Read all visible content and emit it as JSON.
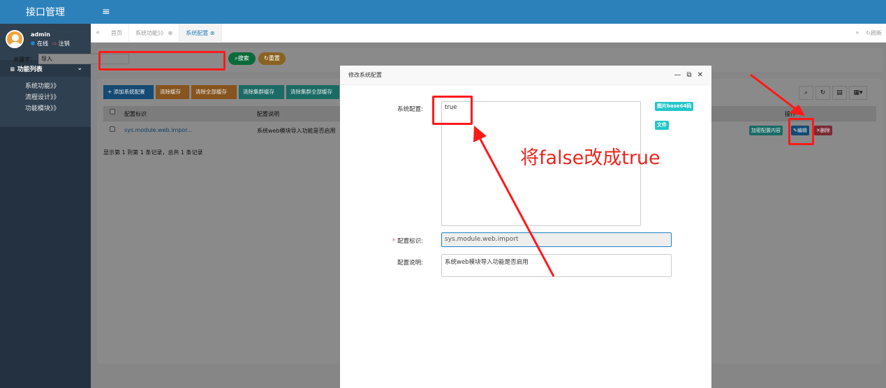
{
  "app": {
    "title": "接口管理"
  },
  "user": {
    "name": "admin",
    "status": "在线",
    "logout": "注销"
  },
  "sidebar": {
    "header": "功能列表",
    "items": [
      {
        "label": "系统功能》》"
      },
      {
        "label": "流程设计》》"
      },
      {
        "label": "功能模块》》"
      }
    ]
  },
  "tabs": {
    "items": [
      {
        "label": "首页"
      },
      {
        "label": "系统功能》》 ⊗"
      },
      {
        "label": "系统配置 ⊗"
      }
    ],
    "refresh": "刷新"
  },
  "search": {
    "label": "关键字：",
    "value": "导入",
    "search_btn": "搜索",
    "reset_btn": "重置"
  },
  "toolbar": {
    "add": "添加系统配置",
    "clear_cache": "清除缓存",
    "clear_all_cache": "清除全部缓存",
    "clear_cluster_cache": "清除集群缓存",
    "clear_cluster_all_cache": "清除集群全部缓存"
  },
  "table": {
    "columns": [
      "配置标识",
      "配置说明",
      "操作"
    ],
    "rows": [
      {
        "key": "sys.module.web.impor...",
        "desc": "系统web模块导入功能是否启用"
      }
    ],
    "actions": {
      "load": "加密配置内容",
      "edit": "编辑",
      "delete": "删除"
    },
    "footer": "显示第 1 到第 1 条记录，总共 1 条记录"
  },
  "modal": {
    "title": "修改系统配置",
    "config_label": "系统配置:",
    "config_value": "true",
    "btn_base64": "图片base64码",
    "btn_file": "文件",
    "key_label": "配置标识:",
    "key_value": "sys.module.web.import",
    "desc_label": "配置说明:",
    "desc_value": "系统web模块导入功能是否启用"
  },
  "annotation": {
    "text": "将false改成true",
    "color": "#e8271d"
  },
  "colors": {
    "primary": "#2c81ba",
    "sidebar": "#2f4050",
    "info": "#23c6c8",
    "danger": "#ed5565"
  }
}
